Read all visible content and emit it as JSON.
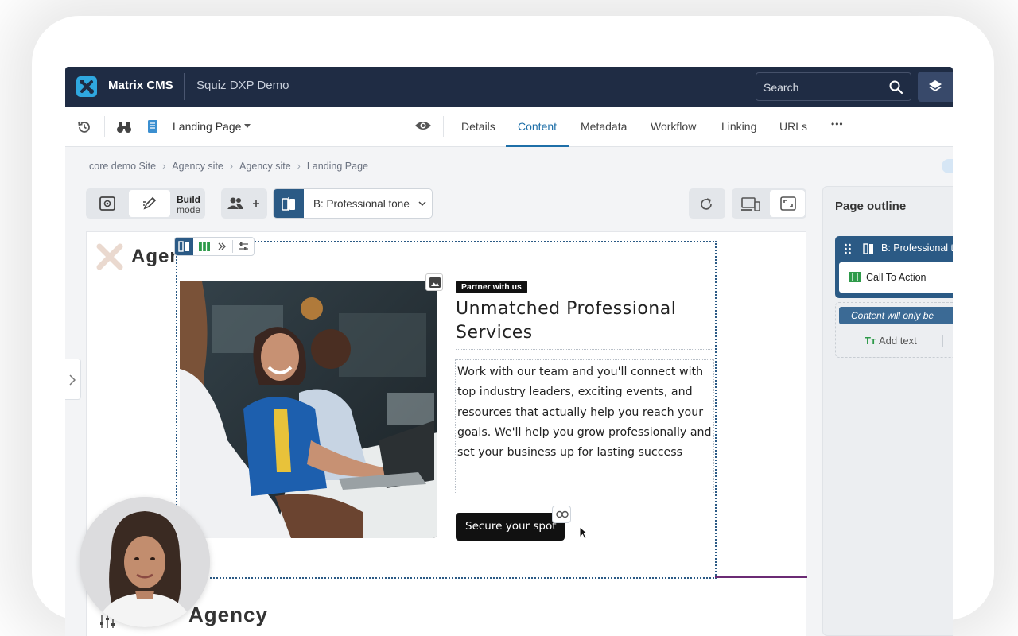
{
  "app": {
    "name": "Matrix CMS",
    "site": "Squiz DXP Demo",
    "search_placeholder": "Search",
    "brand_color": "#1f2c44",
    "accent_color": "#1e6fa8"
  },
  "toolbar": {
    "asset_name": "Landing Page",
    "tabs": [
      {
        "label": "Details",
        "active": false
      },
      {
        "label": "Content",
        "active": true
      },
      {
        "label": "Metadata",
        "active": false
      },
      {
        "label": "Workflow",
        "active": false
      },
      {
        "label": "Linking",
        "active": false
      },
      {
        "label": "URLs",
        "active": false
      }
    ],
    "more_label": "•••"
  },
  "breadcrumb": [
    "core demo Site",
    "Agency site",
    "Agency site",
    "Landing Page"
  ],
  "edit_bar": {
    "build_label_1": "Build",
    "build_label_2": "mode",
    "variant_label": "B: Professional tone"
  },
  "canvas": {
    "logo_text": "Agency",
    "footer_logo_text": "Agency",
    "cta": {
      "badge": "Partner with us",
      "heading": "Unmatched Professional Services",
      "body": "Work with our team and you'll connect with top industry leaders, exciting events, and resources that actually help you reach your goals. We'll help you grow professionally and set your business up for lasting success",
      "button": "Secure your spot"
    }
  },
  "outline": {
    "title": "Page outline",
    "variant_node": "B: Professional t",
    "child_node": "Call To Action",
    "note": "Content will only be",
    "add_text": "Add text",
    "add_text_icon": "Tт"
  }
}
